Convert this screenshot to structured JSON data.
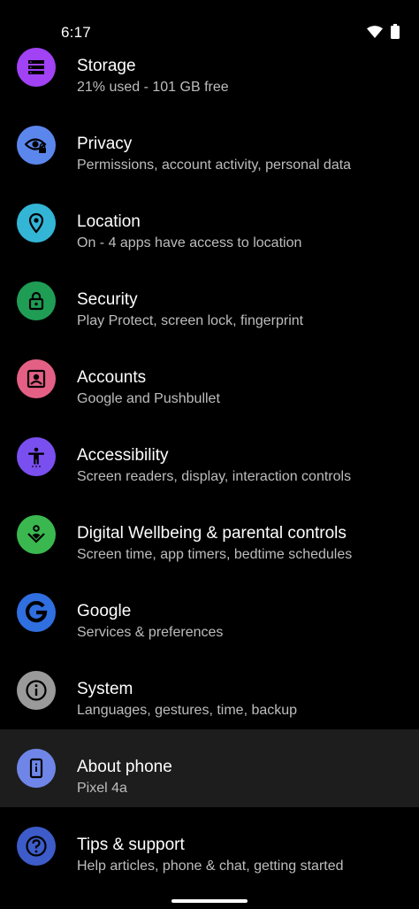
{
  "status_bar": {
    "time": "6:17",
    "icons": [
      "wifi-icon",
      "battery-icon"
    ]
  },
  "settings": {
    "items": [
      {
        "key": "storage",
        "title": "Storage",
        "subtitle": "21% used - 101 GB free",
        "icon": "storage-icon",
        "color": "#a142f4"
      },
      {
        "key": "privacy",
        "title": "Privacy",
        "subtitle": "Permissions, account activity, personal data",
        "icon": "privacy-icon",
        "color": "#5b87ed"
      },
      {
        "key": "location",
        "title": "Location",
        "subtitle": "On - 4 apps have access to location",
        "icon": "location-icon",
        "color": "#33b5d6"
      },
      {
        "key": "security",
        "title": "Security",
        "subtitle": "Play Protect, screen lock, fingerprint",
        "icon": "lock-icon",
        "color": "#1f9d55"
      },
      {
        "key": "accounts",
        "title": "Accounts",
        "subtitle": "Google and Pushbullet",
        "icon": "account-box-icon",
        "color": "#e36084"
      },
      {
        "key": "accessibility",
        "title": "Accessibility",
        "subtitle": "Screen readers, display, interaction controls",
        "icon": "accessibility-icon",
        "color": "#7a4ff0"
      },
      {
        "key": "digital_wellbeing",
        "title": "Digital Wellbeing & parental controls",
        "subtitle": "Screen time, app timers, bedtime schedules",
        "icon": "wellbeing-icon",
        "color": "#3ab84f"
      },
      {
        "key": "google",
        "title": "Google",
        "subtitle": "Services & preferences",
        "icon": "google-g-icon",
        "color": "#2f6fe0"
      },
      {
        "key": "system",
        "title": "System",
        "subtitle": "Languages, gestures, time, backup",
        "icon": "info-icon",
        "color": "#9a9a9a"
      },
      {
        "key": "about_phone",
        "title": "About phone",
        "subtitle": "Pixel 4a",
        "icon": "phone-icon",
        "color": "#6f86e8",
        "highlighted": true
      },
      {
        "key": "tips_support",
        "title": "Tips & support",
        "subtitle": "Help articles, phone & chat, getting started",
        "icon": "help-icon",
        "color": "#3d5cc9"
      }
    ]
  }
}
